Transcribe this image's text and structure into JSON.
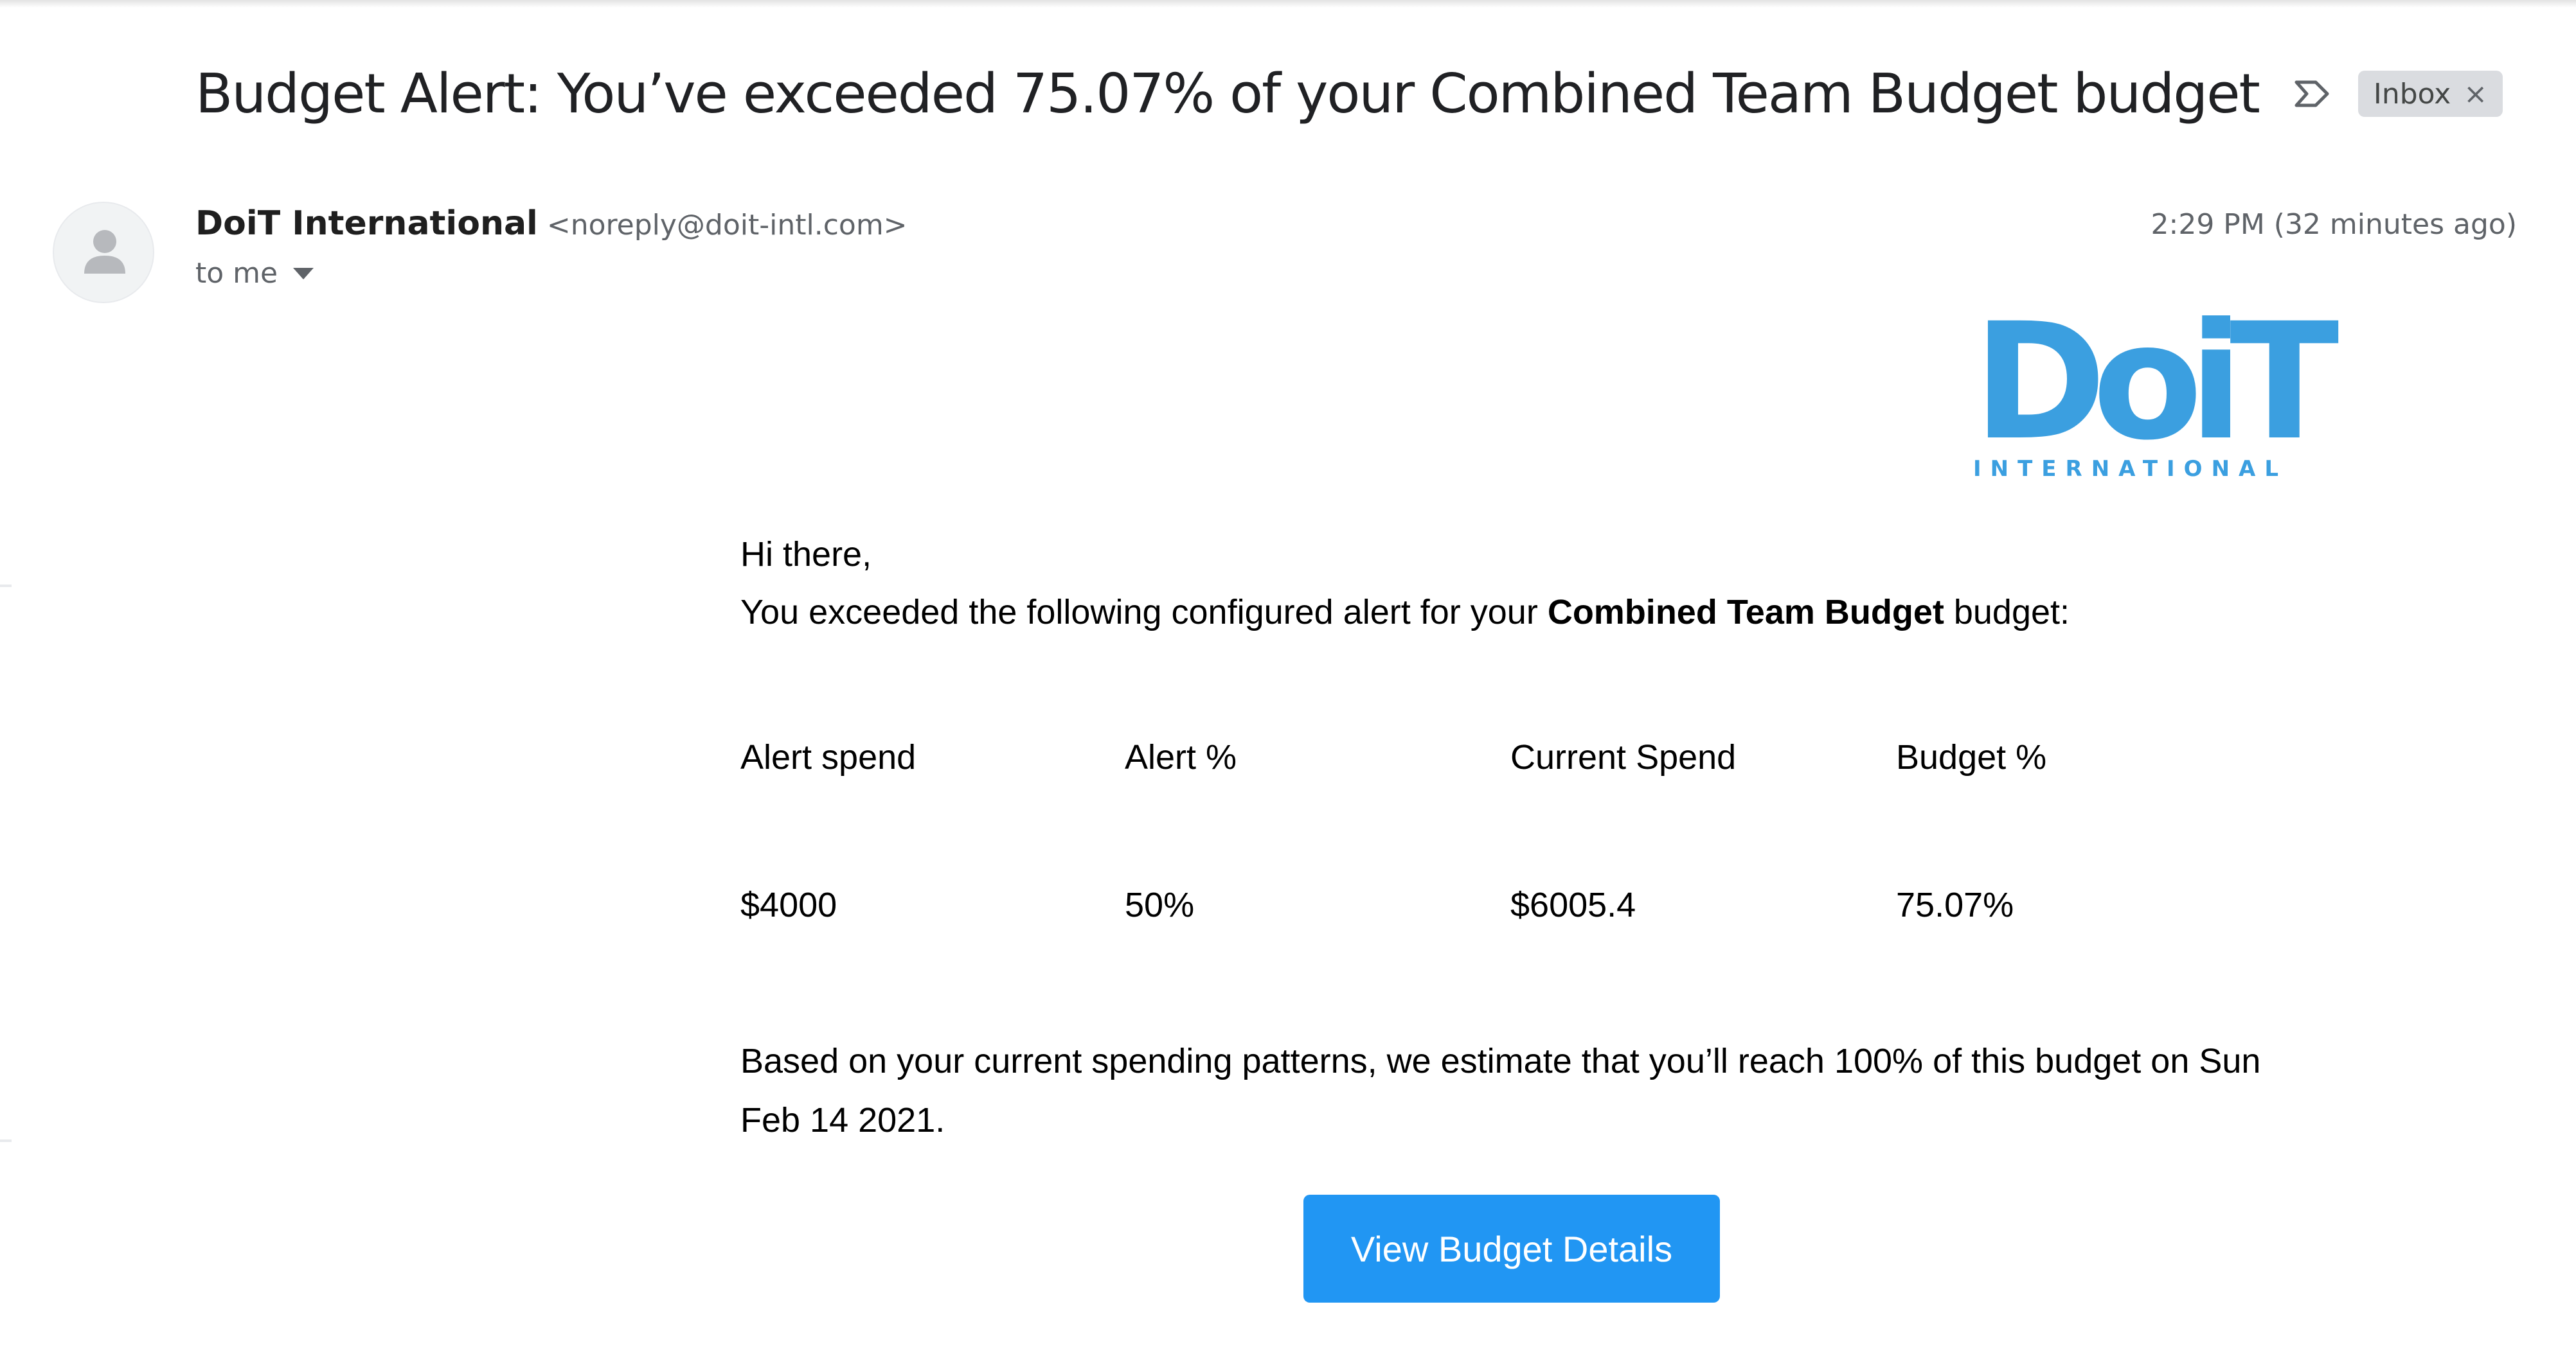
{
  "email": {
    "subject": "Budget Alert: You’ve exceeded 75.07% of your Combined Team Budget budget",
    "label_chip": "Inbox",
    "label_chip_close": "×",
    "important_icon": "important-marker-icon",
    "close_icon": "close-icon",
    "sender": {
      "name": "DoiT International",
      "email": "<noreply@doit-intl.com>",
      "avatar_icon": "person-icon"
    },
    "recipient": "to me",
    "recipient_dropdown_icon": "caret-down-icon",
    "timestamp": "2:29 PM (32 minutes ago)"
  },
  "body": {
    "logo": {
      "word": "DoiT",
      "subtitle": "INTERNATIONAL"
    },
    "greeting": "Hi there,",
    "intro_prefix": "You exceeded the following configured alert for your ",
    "budget_name": "Combined Team Budget",
    "intro_suffix": " budget:",
    "metrics": [
      {
        "label": "Alert spend",
        "value": "$4000"
      },
      {
        "label": "Alert %",
        "value": "50%"
      },
      {
        "label": "Current Spend",
        "value": "$6005.4"
      },
      {
        "label": "Budget %",
        "value": "75.07%"
      }
    ],
    "forecast": "Based on your current spending patterns, we estimate that you’ll reach 100% of this budget on Sun Feb 14 2021.",
    "cta_label": "View Budget Details"
  },
  "colors": {
    "brand": "#3b9fe0",
    "cta_background": "#2196f3",
    "cta_text": "#ffffff",
    "chip_background": "#dadce0"
  }
}
